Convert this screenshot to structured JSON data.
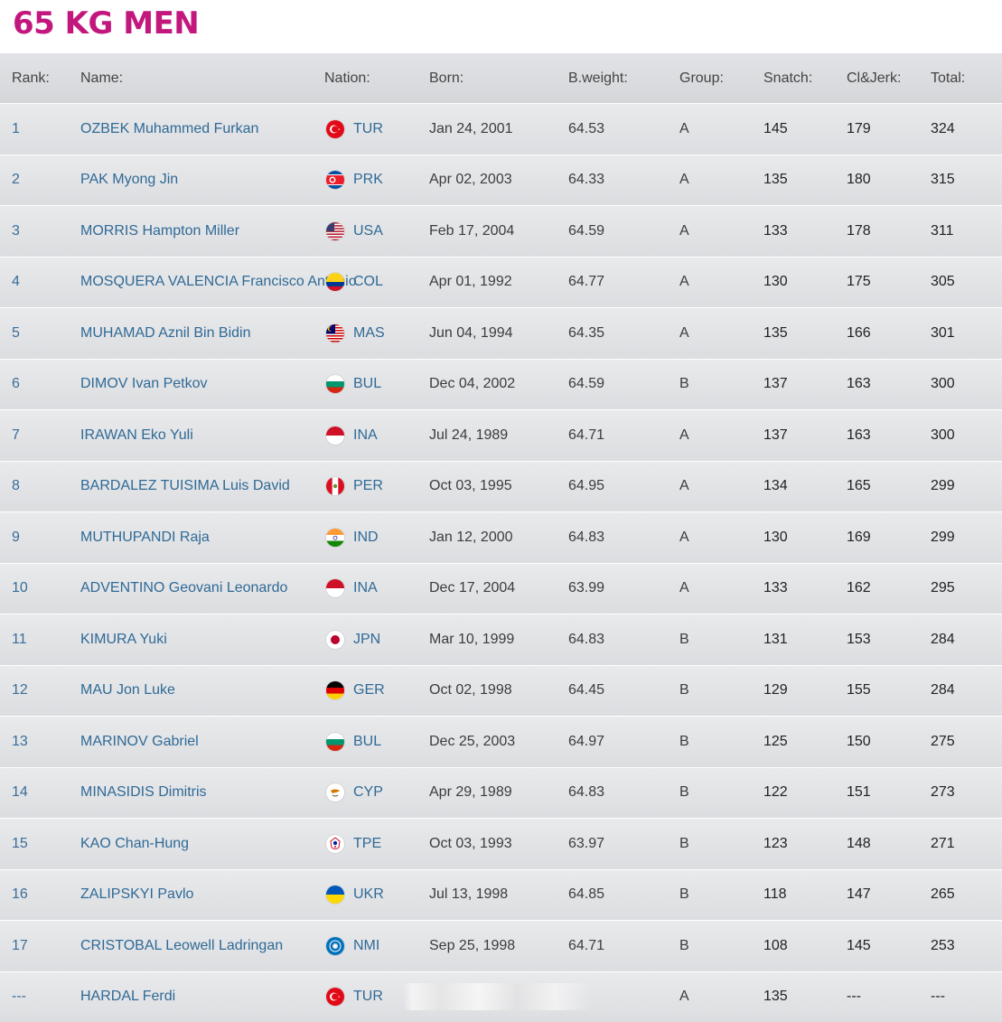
{
  "title": "65 KG MEN",
  "headers": {
    "rank": "Rank:",
    "name": "Name:",
    "nation": "Nation:",
    "born": "Born:",
    "bweight": "B.weight:",
    "group": "Group:",
    "snatch": "Snatch:",
    "cj": "Cl&Jerk:",
    "total": "Total:"
  },
  "rows": [
    {
      "rank": "1",
      "name": "OZBEK Muhammed Furkan",
      "nation": "TUR",
      "flag": "turkey-flag-icon",
      "born": "Jan 24, 2001",
      "bweight": "64.53",
      "group": "A",
      "snatch": "145",
      "cj": "179",
      "total": "324"
    },
    {
      "rank": "2",
      "name": "PAK Myong Jin",
      "nation": "PRK",
      "flag": "north-korea-flag-icon",
      "born": "Apr 02, 2003",
      "bweight": "64.33",
      "group": "A",
      "snatch": "135",
      "cj": "180",
      "total": "315"
    },
    {
      "rank": "3",
      "name": "MORRIS Hampton Miller",
      "nation": "USA",
      "flag": "usa-flag-icon",
      "born": "Feb 17, 2004",
      "bweight": "64.59",
      "group": "A",
      "snatch": "133",
      "cj": "178",
      "total": "311"
    },
    {
      "rank": "4",
      "name": "MOSQUERA VALENCIA Francisco Antonio",
      "nation": "COL",
      "flag": "colombia-flag-icon",
      "born": "Apr 01, 1992",
      "bweight": "64.77",
      "group": "A",
      "snatch": "130",
      "cj": "175",
      "total": "305"
    },
    {
      "rank": "5",
      "name": "MUHAMAD Aznil Bin Bidin",
      "nation": "MAS",
      "flag": "malaysia-flag-icon",
      "born": "Jun 04, 1994",
      "bweight": "64.35",
      "group": "A",
      "snatch": "135",
      "cj": "166",
      "total": "301"
    },
    {
      "rank": "6",
      "name": "DIMOV Ivan Petkov",
      "nation": "BUL",
      "flag": "bulgaria-flag-icon",
      "born": "Dec 04, 2002",
      "bweight": "64.59",
      "group": "B",
      "snatch": "137",
      "cj": "163",
      "total": "300"
    },
    {
      "rank": "7",
      "name": "IRAWAN Eko Yuli",
      "nation": "INA",
      "flag": "indonesia-flag-icon",
      "born": "Jul 24, 1989",
      "bweight": "64.71",
      "group": "A",
      "snatch": "137",
      "cj": "163",
      "total": "300"
    },
    {
      "rank": "8",
      "name": "BARDALEZ TUISIMA Luis David",
      "nation": "PER",
      "flag": "peru-flag-icon",
      "born": "Oct 03, 1995",
      "bweight": "64.95",
      "group": "A",
      "snatch": "134",
      "cj": "165",
      "total": "299"
    },
    {
      "rank": "9",
      "name": "MUTHUPANDI Raja",
      "nation": "IND",
      "flag": "india-flag-icon",
      "born": "Jan 12, 2000",
      "bweight": "64.83",
      "group": "A",
      "snatch": "130",
      "cj": "169",
      "total": "299"
    },
    {
      "rank": "10",
      "name": "ADVENTINO Geovani Leonardo",
      "nation": "INA",
      "flag": "indonesia-flag-icon",
      "born": "Dec 17, 2004",
      "bweight": "63.99",
      "group": "A",
      "snatch": "133",
      "cj": "162",
      "total": "295"
    },
    {
      "rank": "11",
      "name": "KIMURA Yuki",
      "nation": "JPN",
      "flag": "japan-flag-icon",
      "born": "Mar 10, 1999",
      "bweight": "64.83",
      "group": "B",
      "snatch": "131",
      "cj": "153",
      "total": "284"
    },
    {
      "rank": "12",
      "name": "MAU Jon Luke",
      "nation": "GER",
      "flag": "germany-flag-icon",
      "born": "Oct 02, 1998",
      "bweight": "64.45",
      "group": "B",
      "snatch": "129",
      "cj": "155",
      "total": "284"
    },
    {
      "rank": "13",
      "name": "MARINOV Gabriel",
      "nation": "BUL",
      "flag": "bulgaria-flag-icon",
      "born": "Dec 25, 2003",
      "bweight": "64.97",
      "group": "B",
      "snatch": "125",
      "cj": "150",
      "total": "275"
    },
    {
      "rank": "14",
      "name": "MINASIDIS Dimitris",
      "nation": "CYP",
      "flag": "cyprus-flag-icon",
      "born": "Apr 29, 1989",
      "bweight": "64.83",
      "group": "B",
      "snatch": "122",
      "cj": "151",
      "total": "273"
    },
    {
      "rank": "15",
      "name": "KAO Chan-Hung",
      "nation": "TPE",
      "flag": "chinese-taipei-flag-icon",
      "born": "Oct 03, 1993",
      "bweight": "63.97",
      "group": "B",
      "snatch": "123",
      "cj": "148",
      "total": "271"
    },
    {
      "rank": "16",
      "name": "ZALIPSKYI Pavlo",
      "nation": "UKR",
      "flag": "ukraine-flag-icon",
      "born": "Jul 13, 1998",
      "bweight": "64.85",
      "group": "B",
      "snatch": "118",
      "cj": "147",
      "total": "265"
    },
    {
      "rank": "17",
      "name": "CRISTOBAL Leowell Ladringan",
      "nation": "NMI",
      "flag": "northern-mariana-flag-icon",
      "born": "Sep 25, 1998",
      "bweight": "64.71",
      "group": "B",
      "snatch": "108",
      "cj": "145",
      "total": "253"
    },
    {
      "rank": "---",
      "name": "HARDAL Ferdi",
      "nation": "TUR",
      "flag": "turkey-flag-icon",
      "born": "",
      "bweight": "",
      "group": "A",
      "snatch": "135",
      "cj": "---",
      "total": "---"
    }
  ],
  "colors": {
    "title": "#c2187e",
    "link": "#2f6a96",
    "row_bg": "#e2e3e6"
  }
}
